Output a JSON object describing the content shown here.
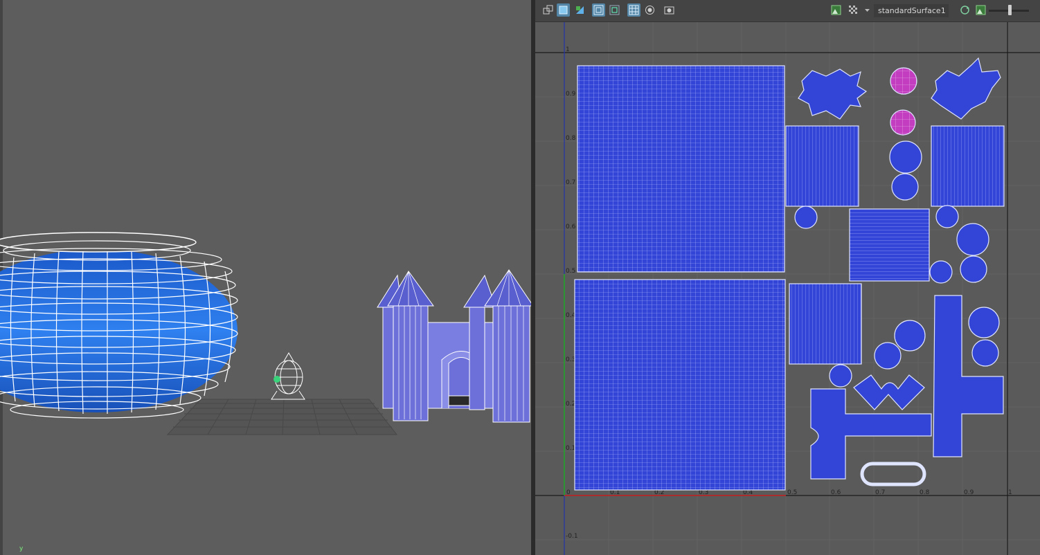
{
  "viewport3d": {
    "axis_label": "y",
    "objects": [
      "pot",
      "small-character",
      "castle",
      "ground-grid"
    ]
  },
  "uv_editor": {
    "toolbar": {
      "material_name": "standardSurface1",
      "buttons": [
        "uv-grid-icon",
        "shaded-uv-icon",
        "distortion-icon",
        "frame-all-icon",
        "frame-selection-icon",
        "grid-toggle-icon",
        "pixel-snap-icon",
        "screenshot-icon",
        "image-display-icon",
        "checker-icon",
        "dropdown-icon",
        "texture-refresh-icon",
        "texture-image-icon"
      ]
    },
    "axis_labels_x": [
      "0",
      "0.1",
      "0.2",
      "0.3",
      "0.4",
      "0.5",
      "0.6",
      "0.7",
      "0.8",
      "0.9",
      "1"
    ],
    "axis_labels_y": [
      "1",
      "0.9",
      "0.8",
      "0.7",
      "0.6",
      "0.5",
      "0.4",
      "0.3",
      "0.2",
      "0.1",
      "-0.1"
    ]
  },
  "colors": {
    "viewport_bg": "#5d5d5d",
    "uv_bg": "#5a5a5a",
    "uv_fill": "#3345d6",
    "uv_selected_fill": "#c23dbf",
    "pot_blue": "#2a6ee0",
    "castle_fill": "#6c70d8",
    "toolbar_active": "#5285a6"
  }
}
